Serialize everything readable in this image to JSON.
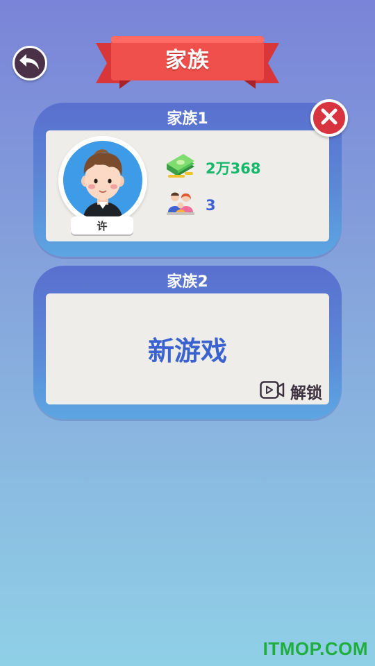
{
  "header": {
    "title": "家族"
  },
  "families": [
    {
      "title": "家族1",
      "member_name": "许",
      "money": "2万368",
      "members": "3"
    },
    {
      "title": "家族2",
      "new_game_label": "新游戏",
      "unlock_label": "解锁"
    }
  ],
  "watermark": "ITMOP.COM",
  "icons": {
    "back": "back-arrow-icon",
    "close": "close-icon",
    "money": "money-stack-icon",
    "members": "family-icon",
    "video": "video-play-icon"
  },
  "colors": {
    "ribbon": "#f0504c",
    "close": "#d8343f",
    "money_text": "#12b86a",
    "members_text": "#3f63d1",
    "new_game_text": "#3b63cf"
  }
}
